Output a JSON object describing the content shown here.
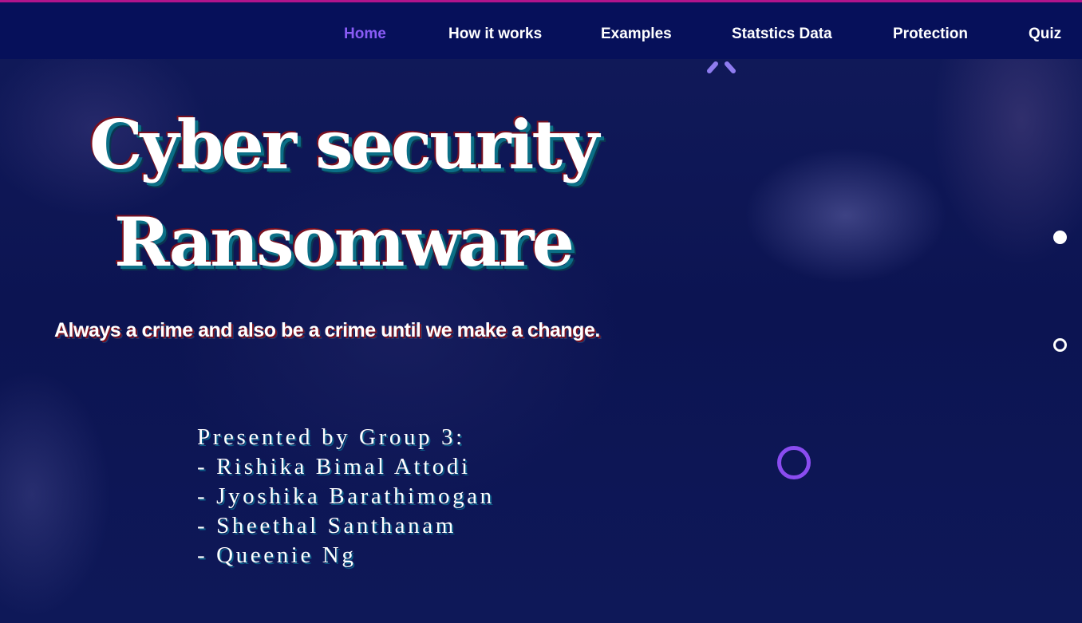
{
  "nav": {
    "items": [
      {
        "label": "Home"
      },
      {
        "label": "How it works"
      },
      {
        "label": "Examples"
      },
      {
        "label": "Statstics Data"
      },
      {
        "label": "Protection"
      },
      {
        "label": "Quiz"
      }
    ],
    "active": "Home"
  },
  "hero": {
    "title_line1": "Cyber security",
    "title_line2": "Ransomware",
    "tagline": "Always a crime and also be a crime until we make a change.",
    "presenters": {
      "heading": "Presented by Group 3:",
      "names": [
        "- Rishika Bimal Attodi",
        "- Jyoshika Barathimogan",
        "- Sheethal Santhanam",
        "- Queenie Ng"
      ]
    }
  },
  "icons": {
    "scroll_up": "chevron-up-icon",
    "slide_dots": [
      "slide-dot-active",
      "slide-dot-inactive"
    ],
    "decoration": "ring-icon"
  },
  "colors": {
    "accent": "#8a5cf6",
    "nav_background": "#06105a",
    "top_border": "#b0148c",
    "page_background": "#0d1550"
  }
}
